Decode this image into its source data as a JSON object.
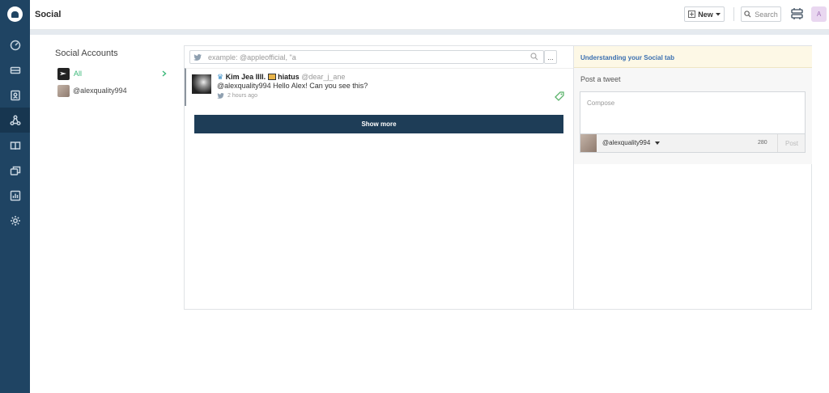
{
  "topbar": {
    "title": "Social",
    "new_label": "New",
    "search_label": "Search",
    "avatar_initial": "A"
  },
  "sidebar": {
    "items": [
      {
        "icon": "dashboard-icon"
      },
      {
        "icon": "tickets-icon"
      },
      {
        "icon": "contacts-icon"
      },
      {
        "icon": "social-icon",
        "active": true
      },
      {
        "icon": "knowledge-base-icon"
      },
      {
        "icon": "forums-icon"
      },
      {
        "icon": "reports-icon"
      },
      {
        "icon": "settings-icon"
      }
    ]
  },
  "accounts": {
    "title": "Social Accounts",
    "all_label": "All",
    "user_handle": "@alexquality994",
    "accent": "#3cb97a"
  },
  "search": {
    "placeholder": "example: @appleofficial, \"a",
    "more_label": "..."
  },
  "tweet": {
    "name": "Kim Jea IIII.",
    "status": "hiatus",
    "handle": "@dear_j_ane",
    "text": "@alexquality994 Hello Alex! Can you see this?",
    "time": "2 hours ago"
  },
  "show_more_label": "Show more",
  "right": {
    "understanding": "Understanding your Social tab",
    "post_label": "Post a tweet",
    "compose_placeholder": "Compose",
    "account": "@alexquality994",
    "char_count": "280",
    "post_button": "Post"
  }
}
